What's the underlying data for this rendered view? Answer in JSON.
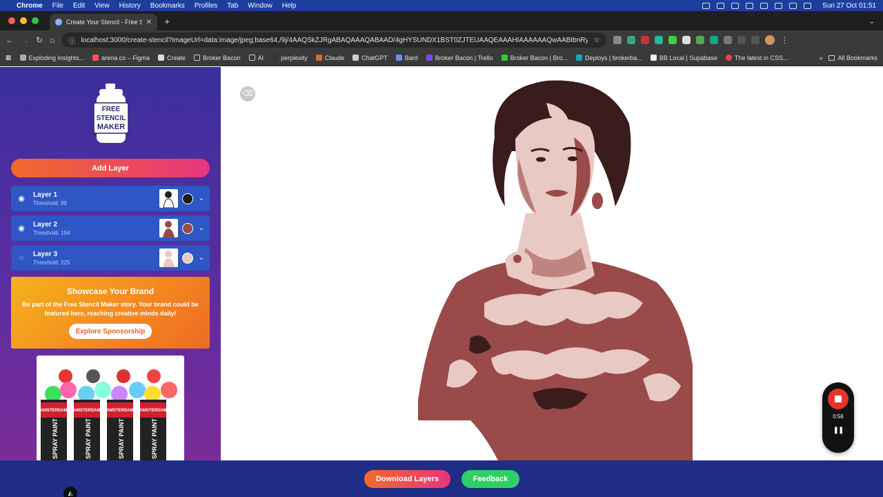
{
  "menubar": {
    "apple_icon": "apple-icon",
    "items": [
      "Chrome",
      "File",
      "Edit",
      "View",
      "History",
      "Bookmarks",
      "Profiles",
      "Tab",
      "Window",
      "Help"
    ],
    "clock": "Sun 27 Oct  01:51"
  },
  "browser": {
    "tab_title": "Create Your Stencil - Free Ste",
    "url": "localhost:3000/create-stencil?imageUrl=data:image/jpeg;base64,/9j/4AAQSkZJRgABAQAAAQABAAD/4gHYSUNDX1BST0ZJTEUAAQEAAAHIAAAAAAQwAABtbnRyUkd...",
    "bookmarks": [
      "Exploding Insights...",
      "arena.co – Figma",
      "Create",
      "Broker Bacon",
      "AI",
      "perplexity",
      "Claude",
      "ChatGPT",
      "Bard",
      "Broker Bacon | Trello",
      "Broker Bacon | Bro...",
      "Deploys | brokerba...",
      "BB Local | Supabase",
      "The latest in CSS..."
    ],
    "all_bookmarks": "All Bookmarks"
  },
  "app": {
    "logo_text": [
      "FREE",
      "STENCIL",
      "MAKER"
    ],
    "add_layer_label": "Add Layer",
    "layers": [
      {
        "name": "Layer 1",
        "threshold": "Threshold: 89",
        "color": "#1c1c1c",
        "visible": true
      },
      {
        "name": "Layer 2",
        "threshold": "Threshold: 154",
        "color": "#9a4a48",
        "visible": true
      },
      {
        "name": "Layer 3",
        "threshold": "Threshold: 225",
        "color": "#e9c9c4",
        "visible": false
      }
    ],
    "sponsor": {
      "title": "Showcase Your Brand",
      "body": "Be part of the Free Stencil Maker story. Your brand could be featured here, reaching creative minds daily!",
      "cta": "Explore Sponsorship"
    },
    "ad_can_labels": [
      "AMSTERDAM",
      "SPRAY PAINT"
    ],
    "download_label": "Download Layers",
    "feedback_label": "Feedback"
  },
  "recorder": {
    "time": "0:56"
  },
  "colors": {
    "accent_gradient_start": "#f26a2b",
    "accent_gradient_end": "#e8347e",
    "feedback_green": "#2fcf66",
    "layer_blue": "#2e56c4"
  }
}
